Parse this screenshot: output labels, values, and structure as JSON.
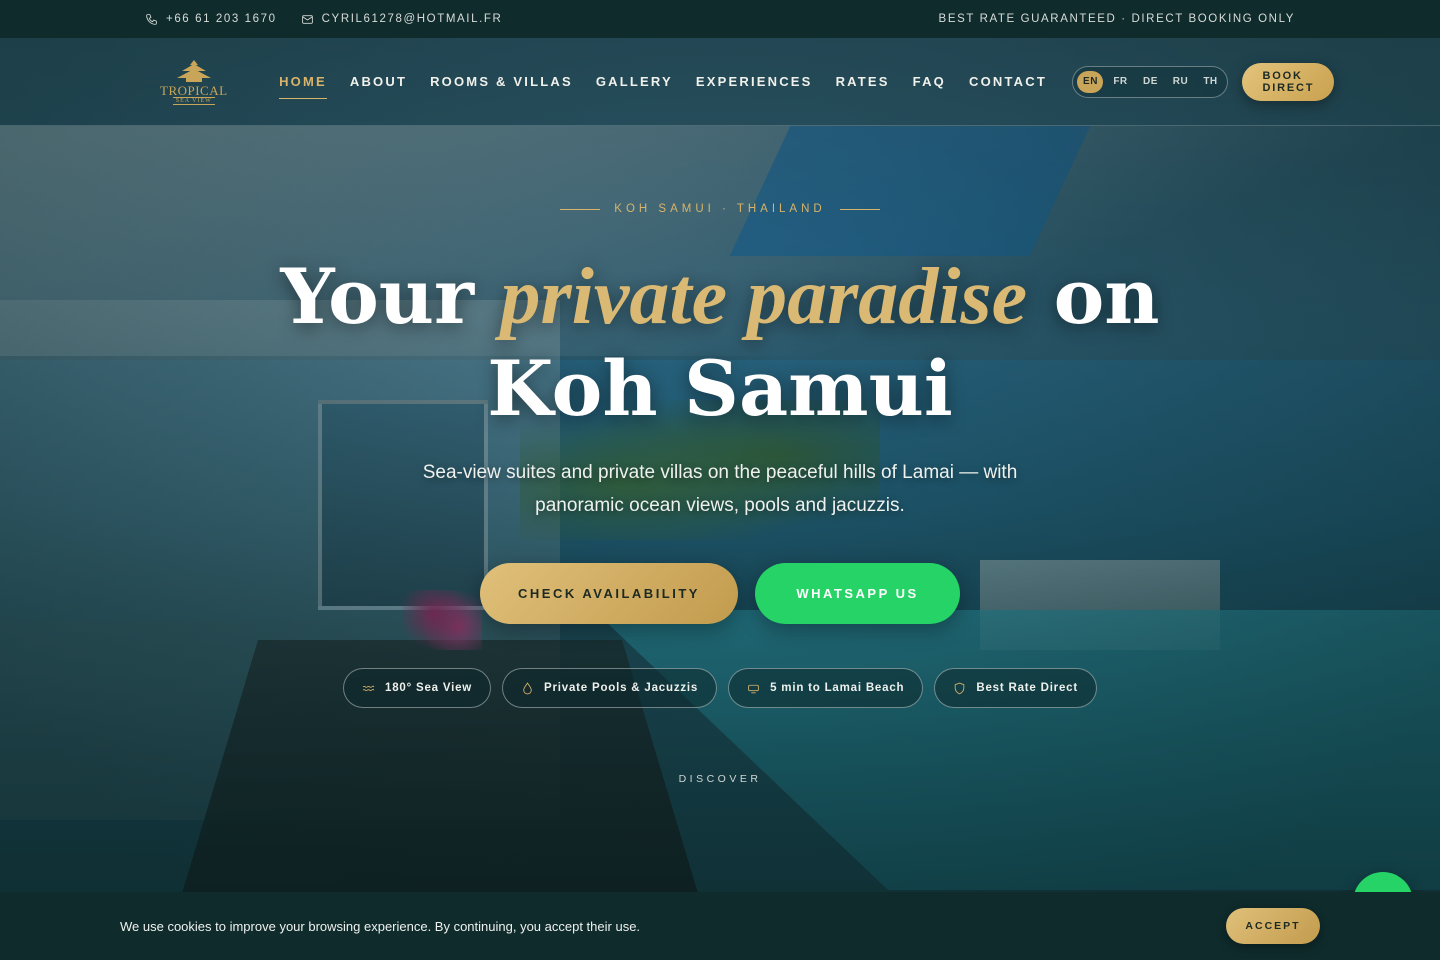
{
  "topbar": {
    "phone": "+66 61 203 1670",
    "email": "CYRIL61278@HOTMAIL.FR",
    "tagline": "BEST RATE GUARANTEED · DIRECT BOOKING ONLY"
  },
  "logo": {
    "name": "TROPICAL",
    "sub": "SEA VIEW"
  },
  "nav": {
    "items": [
      "HOME",
      "ABOUT",
      "ROOMS & VILLAS",
      "GALLERY",
      "EXPERIENCES",
      "RATES",
      "FAQ",
      "CONTACT"
    ],
    "active": "HOME",
    "languages": [
      "EN",
      "FR",
      "DE",
      "RU",
      "TH"
    ],
    "active_language": "EN",
    "book_label": "BOOK DIRECT"
  },
  "hero": {
    "eyebrow": "KOH SAMUI · THAILAND",
    "headline_start": "Your",
    "headline_accent": "private paradise",
    "headline_mid": "on",
    "headline_end": "Koh Samui",
    "subtitle_line1": "Sea-view suites and private villas on the peaceful hills of Lamai — with",
    "subtitle_line2": "panoramic ocean views, pools and jacuzzis.",
    "cta_primary": "CHECK AVAILABILITY",
    "cta_secondary": "WHATSAPP US",
    "features": [
      {
        "label": "180° Sea View",
        "icon": "waves-icon"
      },
      {
        "label": "Private Pools & Jacuzzis",
        "icon": "droplet-icon"
      },
      {
        "label": "5 min to Lamai Beach",
        "icon": "sunbed-icon"
      },
      {
        "label": "Best Rate Direct",
        "icon": "shield-icon"
      }
    ],
    "discover": "DISCOVER"
  },
  "cookie": {
    "text": "We use cookies to improve your browsing experience. By continuing, you accept their use.",
    "accept": "ACCEPT"
  },
  "colors": {
    "gold": "#d8b46a",
    "dark": "#0f2b2c",
    "whatsapp": "#25d366"
  }
}
